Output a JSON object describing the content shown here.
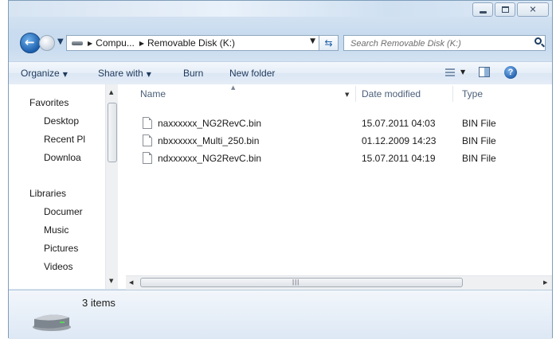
{
  "window": {
    "controls": [
      "minimize",
      "maximize",
      "close"
    ]
  },
  "address": {
    "crumbs": [
      "Compu...",
      "Removable Disk (K:)"
    ],
    "search_placeholder": "Search Removable Disk (K:)"
  },
  "toolbar": {
    "organize": "Organize",
    "share_with": "Share with",
    "burn": "Burn",
    "new_folder": "New folder",
    "help_glyph": "?"
  },
  "nav": {
    "favorites": "Favorites",
    "favorite_items": [
      "Desktop",
      "Recent Pl",
      "Downloa"
    ],
    "libraries": "Libraries",
    "library_items": [
      "Documer",
      "Music",
      "Pictures",
      "Videos"
    ]
  },
  "columns": {
    "name": "Name",
    "date_modified": "Date modified",
    "type": "Type"
  },
  "files": [
    {
      "name": "naxxxxxx_NG2RevC.bin",
      "date": "15.07.2011 04:03",
      "type": "BIN File"
    },
    {
      "name": "nbxxxxxx_Multi_250.bin",
      "date": "01.12.2009 14:23",
      "type": "BIN File"
    },
    {
      "name": "ndxxxxxx_NG2RevC.bin",
      "date": "15.07.2011 04:19",
      "type": "BIN File"
    }
  ],
  "status": {
    "item_count": "3 items"
  },
  "icons": {
    "back": "back-arrow-icon",
    "forward": "forward-arrow-icon",
    "drive": "removable-drive-icon",
    "refresh": "refresh-icon",
    "search": "search-icon",
    "view": "view-options-icon",
    "preview_pane": "preview-pane-icon",
    "help": "help-icon"
  },
  "colors": {
    "accent": "#1e395b",
    "window_frame": "#c9dcef",
    "back_button": "#1c5fad"
  }
}
